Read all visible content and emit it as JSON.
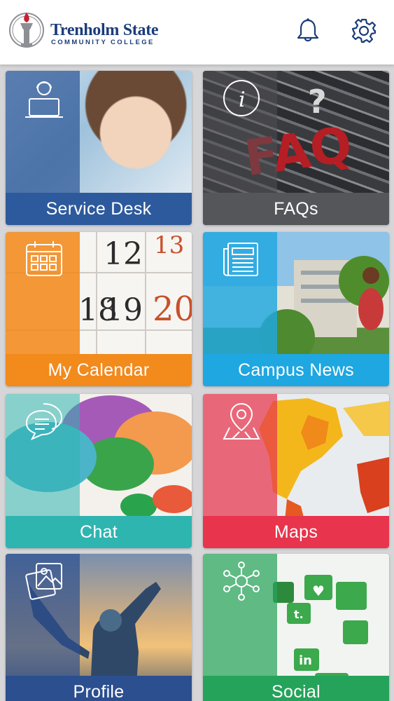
{
  "header": {
    "logo_title": "Trenholm State",
    "logo_subtitle": "COMMUNITY COLLEGE",
    "notification_icon": "bell-icon",
    "settings_icon": "gear-icon"
  },
  "tiles": [
    {
      "label": "Service Desk",
      "icon": "support-agent-icon",
      "color": "#2d5a9c"
    },
    {
      "label": "FAQs",
      "icon": "info-icon",
      "color": "#55565a"
    },
    {
      "label": "My Calendar",
      "icon": "calendar-icon",
      "color": "#f28a1c"
    },
    {
      "label": "Campus News",
      "icon": "newspaper-icon",
      "color": "#1ea7e1"
    },
    {
      "label": "Chat",
      "icon": "chat-bubbles-icon",
      "color": "#2fb5b0"
    },
    {
      "label": "Maps",
      "icon": "map-pin-icon",
      "color": "#e8344c"
    },
    {
      "label": "Profile",
      "icon": "photo-gallery-icon",
      "color": "#2b4f8f"
    },
    {
      "label": "Social",
      "icon": "network-icon",
      "color": "#25a35a"
    }
  ]
}
